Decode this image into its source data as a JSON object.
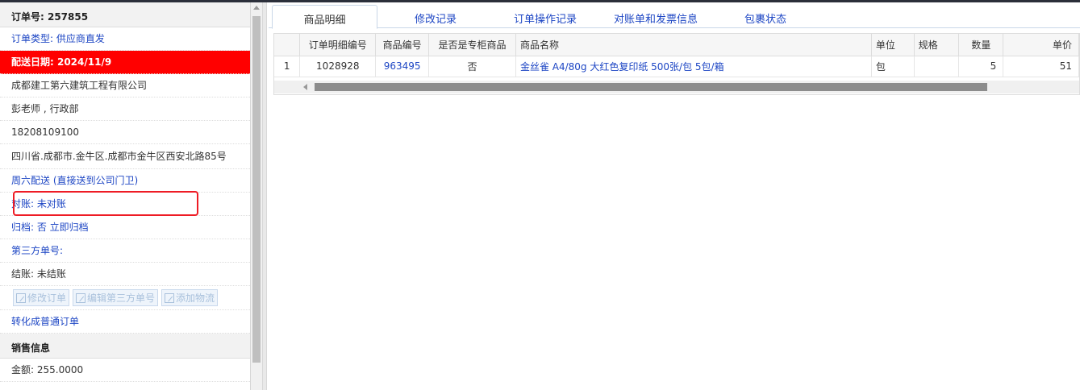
{
  "order": {
    "header": "订单号: 257855",
    "type": "订单类型: 供应商直发",
    "delivery_date": "配送日期: 2024/11/9",
    "company": "成都建工第六建筑工程有限公司",
    "contact": "彭老师 , 行政部",
    "phone": "18208109100",
    "address": "四川省.成都市.金牛区.成都市金牛区西安北路85号",
    "delivery_note": "周六配送 (直接送到公司门卫)",
    "reconcile": "对账: 未对账",
    "archive": "归档: 否 立即归档",
    "third_party": "第三方单号:",
    "settlement": "结账: 未结账",
    "convert_link": "转化成普通订单",
    "sales_header": "销售信息",
    "amount_partial": "金额: 255.0000"
  },
  "actions": {
    "edit_order": "修改订单",
    "edit_third_party": "编辑第三方单号",
    "add_logistics": "添加物流"
  },
  "tabs": [
    "商品明细",
    "修改记录",
    "订单操作记录",
    "对账单和发票信息",
    "包裹状态"
  ],
  "table": {
    "headers": [
      "",
      "订单明细编号",
      "商品编号",
      "是否是专柜商品",
      "商品名称",
      "单位",
      "规格",
      "数量",
      "单价"
    ],
    "rows": [
      [
        "1",
        "1028928",
        "963495",
        "否",
        "金丝雀 A4/80g 大红色复印纸 500张/包 5包/箱",
        "包",
        "",
        "5",
        "51"
      ]
    ]
  },
  "colors": {
    "accent_red": "#ff0000",
    "link_blue": "#1d46c4",
    "highlight_box": "#ee1c25"
  }
}
